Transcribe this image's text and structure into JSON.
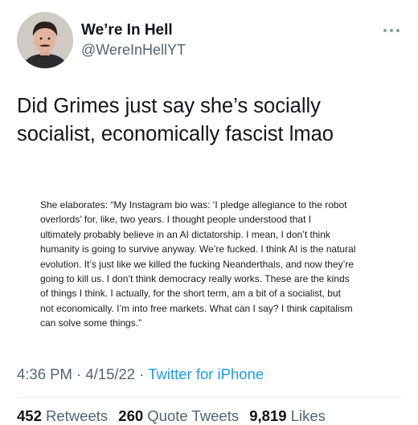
{
  "author": {
    "display_name": "We’re In Hell",
    "handle": "@WereInHellYT"
  },
  "tweet": {
    "text_lines": [
      "Did Grimes just say she’s socially",
      "socialist, economically fascist lmao"
    ]
  },
  "quote_image": {
    "lines": [
      "She elaborates: “My Instagram bio was: ‘I pledge allegiance to the robot",
      "overlords’ for, like, two years. I thought people understood that I",
      "ultimately probably believe in an AI dictatorship. I mean, I don’t think",
      "humanity is going to survive anyway. We’re fucked. I think AI is the natural",
      "evolution. It’s just like we killed the fucking Neanderthals, and now they’re",
      "going to kill us. I don’t think democracy really works. These are the kinds",
      "of things I think. I actually, for the short term, am a bit of a socialist, but",
      "not economically. I’m into free markets. What can I say? I think capitalism",
      "can solve some things.”"
    ]
  },
  "meta": {
    "time": "4:36 PM",
    "separator": " · ",
    "date": "4/15/22",
    "source": "Twitter for iPhone"
  },
  "stats": {
    "retweets_count": "452",
    "retweets_label": "Retweets",
    "quotes_count": "260",
    "quotes_label": "Quote Tweets",
    "likes_count": "9,819",
    "likes_label": "Likes"
  },
  "icons": {
    "more": "more-horizontal-icon",
    "avatar": "avatar"
  },
  "colors": {
    "text": "#0f1419",
    "secondary": "#536471",
    "link": "#1d9bf0"
  }
}
